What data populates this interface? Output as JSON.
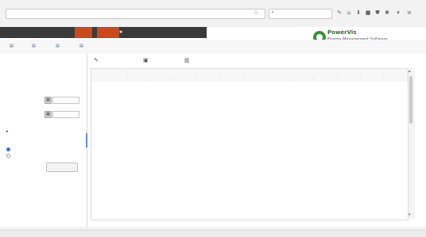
{
  "browser": {
    "url": "",
    "search_text": "",
    "icons": [
      "star-icon",
      "home-icon",
      "download-icon",
      "bookmark-icon",
      "shield-icon",
      "menu-icon"
    ]
  },
  "app": {
    "menu": [
      "",
      "",
      "",
      "",
      "",
      ""
    ],
    "logo_name": "PowerVis",
    "logo_sub": "Energy Management Software"
  },
  "subtoolbar": [
    "",
    "",
    "",
    ""
  ],
  "left": {
    "sections": [
      {
        "title": "",
        "rows": [
          {
            "label": "",
            "value": ""
          },
          {
            "label": "",
            "value": ""
          },
          {
            "label": "",
            "value": ""
          }
        ]
      },
      {
        "title": ""
      },
      {
        "title": ""
      },
      {
        "title": ""
      }
    ],
    "create_label": ""
  },
  "toolbar": {
    "adjust": "",
    "export": "",
    "show": ""
  },
  "table": {
    "group_header": "",
    "columns": [
      "",
      "",
      "",
      "",
      "",
      "",
      "",
      "",
      "",
      "",
      "",
      "",
      ""
    ],
    "rows": []
  },
  "pager": "",
  "status": {
    "left": "",
    "right": ""
  },
  "colors": {
    "accent": "#c84a1e",
    "dark": "#3a3a3a",
    "link": "#2a4f86",
    "logo": "#2f6f2f"
  }
}
